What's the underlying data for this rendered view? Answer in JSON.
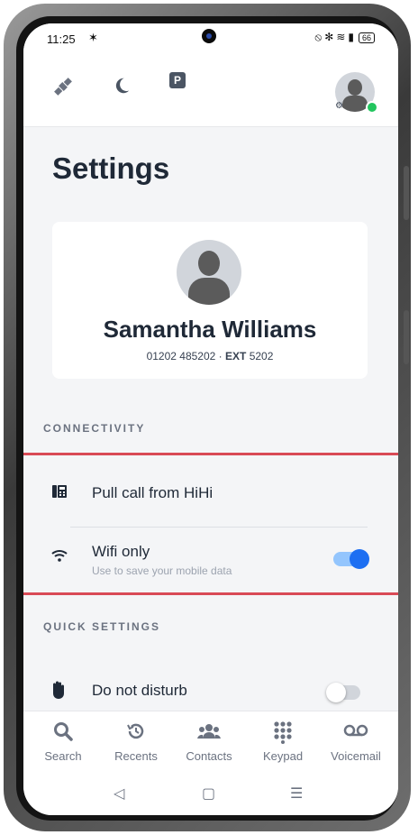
{
  "status_bar": {
    "time": "11:25",
    "battery": "66"
  },
  "page": {
    "title": "Settings"
  },
  "profile": {
    "name": "Samantha Williams",
    "phone": "01202 485202",
    "ext_label": "EXT",
    "ext": "5202"
  },
  "sections": {
    "connectivity": {
      "label": "CONNECTIVITY",
      "pull_call": {
        "label": "Pull call from HiHi"
      },
      "wifi_only": {
        "label": "Wifi only",
        "subtitle": "Use to save your mobile data",
        "enabled": true
      }
    },
    "quick_settings": {
      "label": "QUICK SETTINGS",
      "do_not_disturb": {
        "label": "Do not disturb",
        "enabled": false
      }
    }
  },
  "bottom_nav": {
    "items": [
      {
        "label": "Search",
        "icon": "search-icon"
      },
      {
        "label": "Recents",
        "icon": "recents-icon"
      },
      {
        "label": "Contacts",
        "icon": "contacts-icon"
      },
      {
        "label": "Keypad",
        "icon": "keypad-icon"
      },
      {
        "label": "Voicemail",
        "icon": "voicemail-icon"
      }
    ]
  },
  "colors": {
    "accent": "#1d6ff2",
    "highlight": "#d94a56",
    "online": "#22c55e"
  }
}
